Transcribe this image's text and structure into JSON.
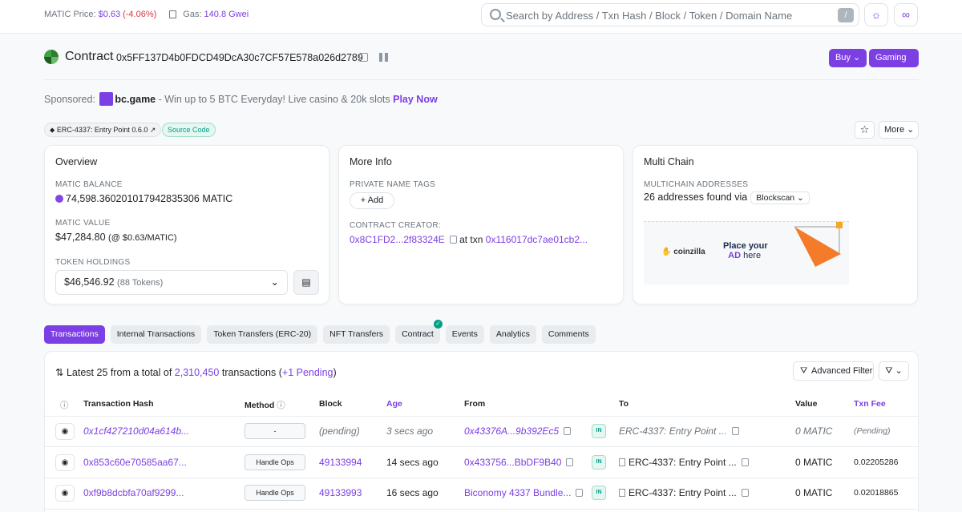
{
  "topbar": {
    "price_label": "MATIC Price:",
    "price_value": "$0.63",
    "price_change": "(-4.06%)",
    "gas_label": "Gas:",
    "gas_value": "140.8 Gwei",
    "search_placeholder": "Search by Address / Txn Hash / Block / Token / Domain Name",
    "search_shortcut": "/"
  },
  "header": {
    "title": "Contract",
    "address": "0x5FF137D4b0FDCD49DcA30c7CF57E578a026d2789",
    "buy_label": "Buy",
    "gaming_label": "Gaming"
  },
  "sponsor": {
    "prefix": "Sponsored:",
    "brand": "bc.game",
    "text": " - Win up to 5 BTC Everyday! Live casino & 20k slots ",
    "cta": "Play Now"
  },
  "tags": {
    "name_tag": "ERC-4337: Entry Point 0.6.0",
    "source_code": "Source Code",
    "more_label": "More"
  },
  "overview": {
    "title": "Overview",
    "balance_label": "MATIC BALANCE",
    "balance_value": "74,598.360201017942835306 MATIC",
    "value_label": "MATIC VALUE",
    "value_value": "$47,284.80",
    "value_rate": "(@ $0.63/MATIC)",
    "holdings_label": "TOKEN HOLDINGS",
    "holdings_value": "$46,546.92",
    "holdings_count": "(88 Tokens)"
  },
  "more_info": {
    "title": "More Info",
    "tags_label": "PRIVATE NAME TAGS",
    "add_label": "+ Add",
    "creator_label": "CONTRACT CREATOR:",
    "creator_addr": "0x8C1FD2...2f83324E",
    "at_txn": "at txn",
    "creator_txn": "0x116017dc7ae01cb2..."
  },
  "multichain": {
    "title": "Multi Chain",
    "label": "MULTICHAIN ADDRESSES",
    "found": "26 addresses found via",
    "provider": "Blockscan",
    "ad_brand": "coinzilla",
    "ad_text_1": "Place ",
    "ad_text_2": "your",
    "ad_text_3": "AD",
    "ad_text_4": " here"
  },
  "tabs": [
    "Transactions",
    "Internal Transactions",
    "Token Transfers (ERC-20)",
    "NFT Transfers",
    "Contract",
    "Events",
    "Analytics",
    "Comments"
  ],
  "transactions": {
    "summary_prefix": "Latest 25 from a total of ",
    "summary_total": "2,310,450",
    "summary_mid": " transactions (",
    "summary_pending": "+1 Pending",
    "summary_end": ")",
    "advanced_filter": "Advanced Filter",
    "columns": {
      "hash": "Transaction Hash",
      "method": "Method",
      "block": "Block",
      "age": "Age",
      "from": "From",
      "to": "To",
      "value": "Value",
      "fee": "Txn Fee"
    },
    "rows": [
      {
        "hash": "0x1cf427210d04a614b...",
        "method": "-",
        "block": "(pending)",
        "age": "3 secs ago",
        "from": "0x43376A...9b392Ec5",
        "dir": "IN",
        "to": "ERC-4337: Entry Point ...",
        "value": "0 MATIC",
        "fee": "(Pending)"
      },
      {
        "hash": "0x853c60e70585aa67...",
        "method": "Handle Ops",
        "block": "49133994",
        "age": "14 secs ago",
        "from": "0x433756...BbDF9B40",
        "dir": "IN",
        "to": "ERC-4337: Entry Point ...",
        "value": "0 MATIC",
        "fee": "0.02205286"
      },
      {
        "hash": "0xf9b8dcbfa70af9299...",
        "method": "Handle Ops",
        "block": "49133993",
        "age": "16 secs ago",
        "from": "Biconomy 4337 Bundle...",
        "dir": "IN",
        "to": "ERC-4337: Entry Point ...",
        "value": "0 MATIC",
        "fee": "0.02018865"
      }
    ]
  },
  "colors": {
    "accent": "#7b3fe4",
    "negative": "#dc3545",
    "success": "#00a186"
  }
}
